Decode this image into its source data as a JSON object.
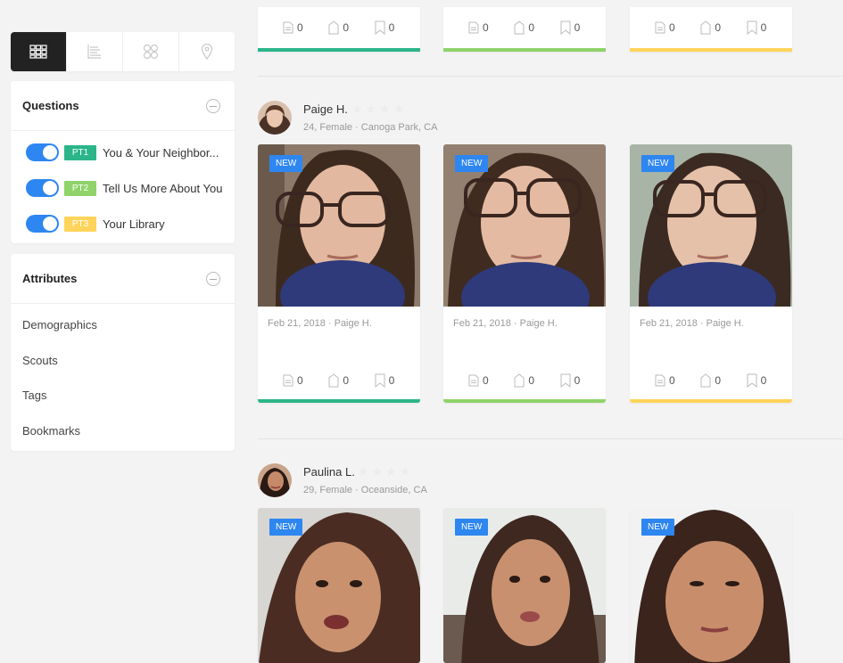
{
  "colors": {
    "accent_blue": "#2e86f0",
    "pt1": "#2bb589",
    "pt2": "#8fd36a",
    "pt3": "#ffd45a",
    "bar_teal": "#2bb589",
    "bar_green": "#8fd36a",
    "bar_yellow": "#ffd45a"
  },
  "view_switch": {
    "buttons": [
      {
        "icon": "grid-view-icon",
        "active": true
      },
      {
        "icon": "list-view-icon",
        "active": false
      },
      {
        "icon": "cluster-view-icon",
        "active": false
      },
      {
        "icon": "map-view-icon",
        "active": false
      }
    ]
  },
  "questions": {
    "title": "Questions",
    "items": [
      {
        "badge": "PT1",
        "label": "You & Your Neighbor...",
        "enabled": true
      },
      {
        "badge": "PT2",
        "label": "Tell Us More About You",
        "enabled": true
      },
      {
        "badge": "PT3",
        "label": "Your Library",
        "enabled": true
      }
    ]
  },
  "attributes": {
    "title": "Attributes",
    "items": [
      "Demographics",
      "Scouts",
      "Tags",
      "Bookmarks"
    ]
  },
  "top_cards": [
    {
      "docs": "0",
      "tags": "0",
      "bookmarks": "0"
    },
    {
      "docs": "0",
      "tags": "0",
      "bookmarks": "0"
    },
    {
      "docs": "0",
      "tags": "0",
      "bookmarks": "0"
    }
  ],
  "participants": [
    {
      "name": "Paige H.",
      "meta": "24, Female · Canoga Park, CA",
      "rating": 0,
      "cards": [
        {
          "badge": "NEW",
          "caption": "Feb 21, 2018 · Paige H.",
          "docs": "0",
          "tags": "0",
          "bookmarks": "0"
        },
        {
          "badge": "NEW",
          "caption": "Feb 21, 2018 · Paige H.",
          "docs": "0",
          "tags": "0",
          "bookmarks": "0"
        },
        {
          "badge": "NEW",
          "caption": "Feb 21, 2018 · Paige H.",
          "docs": "0",
          "tags": "0",
          "bookmarks": "0"
        }
      ]
    },
    {
      "name": "Paulina L.",
      "meta": "29, Female · Oceanside, CA",
      "rating": 0,
      "cards": [
        {
          "badge": "NEW"
        },
        {
          "badge": "NEW"
        },
        {
          "badge": "NEW"
        }
      ]
    }
  ]
}
